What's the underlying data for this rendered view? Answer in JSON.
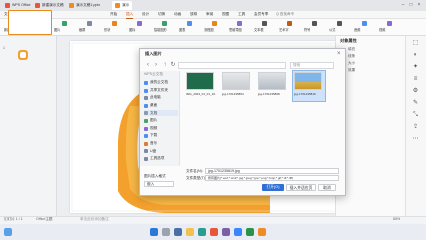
{
  "tabs": [
    {
      "label": "WPS Office",
      "color": "#e8543c",
      "active": false
    },
    {
      "label": "新建演示文稿",
      "color": "#e8543c",
      "active": false
    },
    {
      "label": "演示文稿1.pptx",
      "color": "#f08a24",
      "active": false
    },
    {
      "label": "演示",
      "color": "#f08a24",
      "active": true
    }
  ],
  "menu": {
    "file": "文件",
    "items": [
      "开始",
      "插入",
      "设计",
      "切换",
      "动画",
      "放映",
      "审阅",
      "视图",
      "工具",
      "会员专享"
    ],
    "active_index": 1,
    "search_placeholder": "Q 查找命令"
  },
  "ribbon": {
    "groups": [
      "新建幻灯片",
      "表格",
      "图片",
      "截屏",
      "形状",
      "图标",
      "智能图形",
      "图表",
      "流程图",
      "思维导图",
      "文本框",
      "艺术字",
      "符号",
      "公式",
      "音频",
      "视频"
    ]
  },
  "dialog": {
    "title": "插入图片",
    "search_placeholder": "搜索",
    "sidebar_top": "WPS云文档",
    "sidebar": [
      {
        "label": "我的云文档",
        "color": "#4d8ff0"
      },
      {
        "label": "共享文件夹",
        "color": "#4d8ff0"
      },
      {
        "label": "此电脑",
        "color": "#7a8aa0"
      },
      {
        "label": "桌面",
        "color": "#4d8ff0"
      },
      {
        "label": "文档",
        "color": "#8a9ab0",
        "selected": true
      },
      {
        "label": "图片",
        "color": "#4da06a"
      },
      {
        "label": "视频",
        "color": "#8a6ad0"
      },
      {
        "label": "下载",
        "color": "#4d8ff0"
      },
      {
        "label": "音乐",
        "color": "#e07a3a"
      },
      {
        "label": "U盘",
        "color": "#7a8aa0"
      },
      {
        "label": "工具选项",
        "color": "#7a8aa0"
      }
    ],
    "files": [
      {
        "name": "IMG_2023_01_01_16.54.45",
        "selected": false
      },
      {
        "name": "jpg-1701235854",
        "selected": false
      },
      {
        "name": "jpg-1701235808",
        "selected": false
      },
      {
        "name": "jpg-1701235819",
        "selected": true
      }
    ],
    "filename_label": "文件名(N):",
    "filename_value": "jpg-1701235819.jpg",
    "filetype_label": "文件类型(T):",
    "filetype_value": "所有图片(*.emf;*.wmf;*.jpg;*.jpeg;*.jpe;*.png;*.bmp;*.gif;*.tif;*.tiff)",
    "bottom_left": "图片插入格式",
    "bottom_option": "嵌入",
    "open_label": "打开(O)",
    "insert_label": "插入并适应页",
    "cancel_label": "取消"
  },
  "right_panel": {
    "title": "对象属性",
    "items": [
      "填充",
      "线条",
      "大小",
      "效果"
    ]
  },
  "status": {
    "slide_info": "幻灯片 1 / 1",
    "theme": "Office主题",
    "notes": "单击此处添加备注",
    "zoom": "65%"
  },
  "thumb_number": "1",
  "colors": {
    "accent": "#c25a12",
    "orange_shape": "#f3a12c",
    "orange_dark": "#e8841a",
    "primary_button": "#2f6fd6",
    "selection": "#cfe2fb"
  }
}
